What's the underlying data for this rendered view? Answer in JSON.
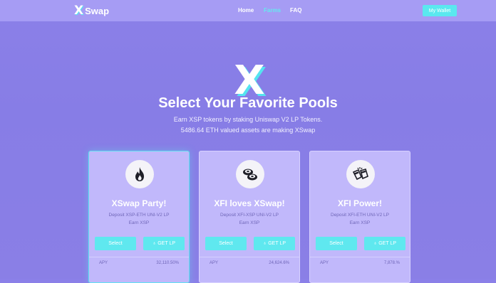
{
  "header": {
    "logo_x": "X",
    "logo_text": "Swap",
    "nav": [
      {
        "label": "Home"
      },
      {
        "label": "Farms"
      },
      {
        "label": "FAQ"
      }
    ],
    "wallet_label": "My Wallet"
  },
  "hero": {
    "logo_letter": "X",
    "title": "Select Your Favorite Pools",
    "subtitle_line1": "Earn XSP tokens by staking Uniswap V2 LP Tokens.",
    "subtitle_line2": "5486.64 ETH valued assets are making XSwap"
  },
  "pools": [
    {
      "icon": "fire-icon",
      "title": "XSwap Party!",
      "deposit": "Deposit XSP-ETH UNI-V2 LP",
      "earn": "Earn XSP",
      "select_label": "Select",
      "get_lp_label": "GET LP",
      "apy_label": "APY",
      "apy_value": "32,110.50%"
    },
    {
      "icon": "sushi-icon",
      "title": "XFI loves XSwap!",
      "deposit": "Deposit XFI-XSP UNI-V2 LP",
      "earn": "Earn XSP",
      "select_label": "Select",
      "get_lp_label": "GET LP",
      "apy_label": "APY",
      "apy_value": "24,624.6%"
    },
    {
      "icon": "toast-icon",
      "title": "XFI Power!",
      "deposit": "Deposit XFI-ETH UNI-V2 LP",
      "earn": "Earn XSP",
      "select_label": "Select",
      "get_lp_label": "GET LP",
      "apy_label": "APY",
      "apy_value": "7,878.%"
    }
  ],
  "colors": {
    "background": "#8b80e8",
    "topbar": "#a69cf4",
    "accent": "#5fe8ef",
    "card": "#c1b8fb"
  }
}
